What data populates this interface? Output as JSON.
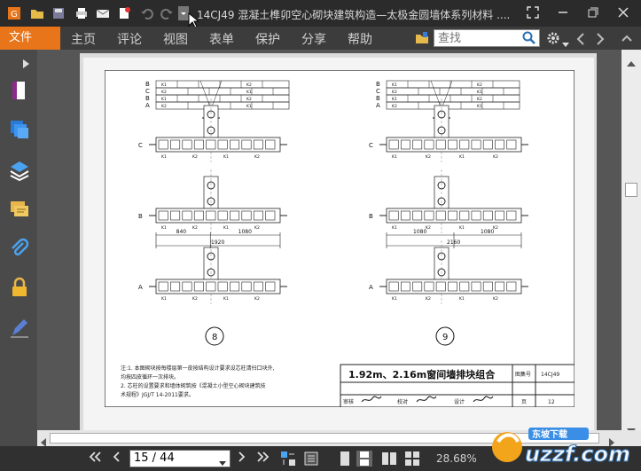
{
  "window": {
    "title": "14CJ49  混凝土榫卯空心砌块建筑构造—太极金圆墙体系列材料 ...."
  },
  "menu": {
    "file_tab": "文件",
    "items": [
      "主页",
      "评论",
      "视图",
      "表单",
      "保护",
      "分享",
      "帮助"
    ],
    "search_placeholder": "查找"
  },
  "statusbar": {
    "page_indicator": "15 / 44",
    "zoom": "28.68%"
  },
  "drawing": {
    "row_labels_top": [
      "B",
      "C",
      "B",
      "A"
    ],
    "elevation_label": "立面",
    "axis_labels": [
      "C",
      "B",
      "A"
    ],
    "left_dims": {
      "a": "840",
      "b": "1080",
      "total": "1920"
    },
    "right_dims": {
      "a": "1080",
      "b": "1080",
      "total": "2160"
    },
    "left_circle": "8",
    "right_circle": "9",
    "notes": [
      "注:1.  本图砌块按每楼层第一皮按结构设计要求设芯柱清扫口块外,",
      "        均按四皮循环一次排块。",
      "      2.  芯柱的设置要求和墙体砌筑按《混凝土小型空心砌块建筑技",
      "        术规程》JGJ/T 14-2011要求。"
    ],
    "title_block": {
      "title": "1.92m、2.16m窗间墙排块组合",
      "atlas_label": "图集号",
      "atlas_no": "14CJ49",
      "review": "审核",
      "check": "校对",
      "design": "设计",
      "page_label": "页",
      "page_no": "12"
    },
    "block_labels": [
      "K1",
      "K2",
      "K3"
    ]
  },
  "watermark": {
    "text": "uzzf.com",
    "cn": "东坡下载"
  },
  "colors": {
    "accent": "#e8751a",
    "titlebar": "#2b2b2b",
    "menubar": "#3c3c3c",
    "sidebar": "#4a4a4a",
    "doc_bg": "#565656",
    "page": "#f4f4f4"
  }
}
